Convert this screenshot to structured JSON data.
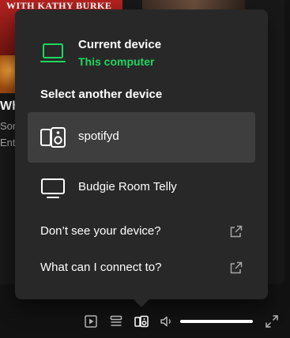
{
  "background": {
    "cover_title": "WITH KATHY BURKE",
    "row_title": "Wh",
    "row_sub1": "Son",
    "row_sub2": "Ente"
  },
  "device_picker": {
    "current": {
      "title": "Current device",
      "subtitle": "This computer",
      "icon": "laptop-icon"
    },
    "select_heading": "Select another device",
    "devices": [
      {
        "label": "spotifyd",
        "icon": "speaker-device-icon",
        "active": true
      },
      {
        "label": "Budgie Room Telly",
        "icon": "tv-icon",
        "active": false
      }
    ],
    "help_links": [
      {
        "label": "Don’t see your device?",
        "icon": "external-link-icon"
      },
      {
        "label": "What can I connect to?",
        "icon": "external-link-icon"
      }
    ]
  },
  "player_controls": {
    "buttons": [
      "now-playing-view-icon",
      "queue-icon",
      "connect-device-icon",
      "volume-icon",
      "fullscreen-icon"
    ],
    "volume": 1.0
  },
  "colors": {
    "accent_green": "#1ed760",
    "popup_bg": "#282828",
    "active_row_bg": "#3e3e3e",
    "app_bg": "#121212"
  }
}
